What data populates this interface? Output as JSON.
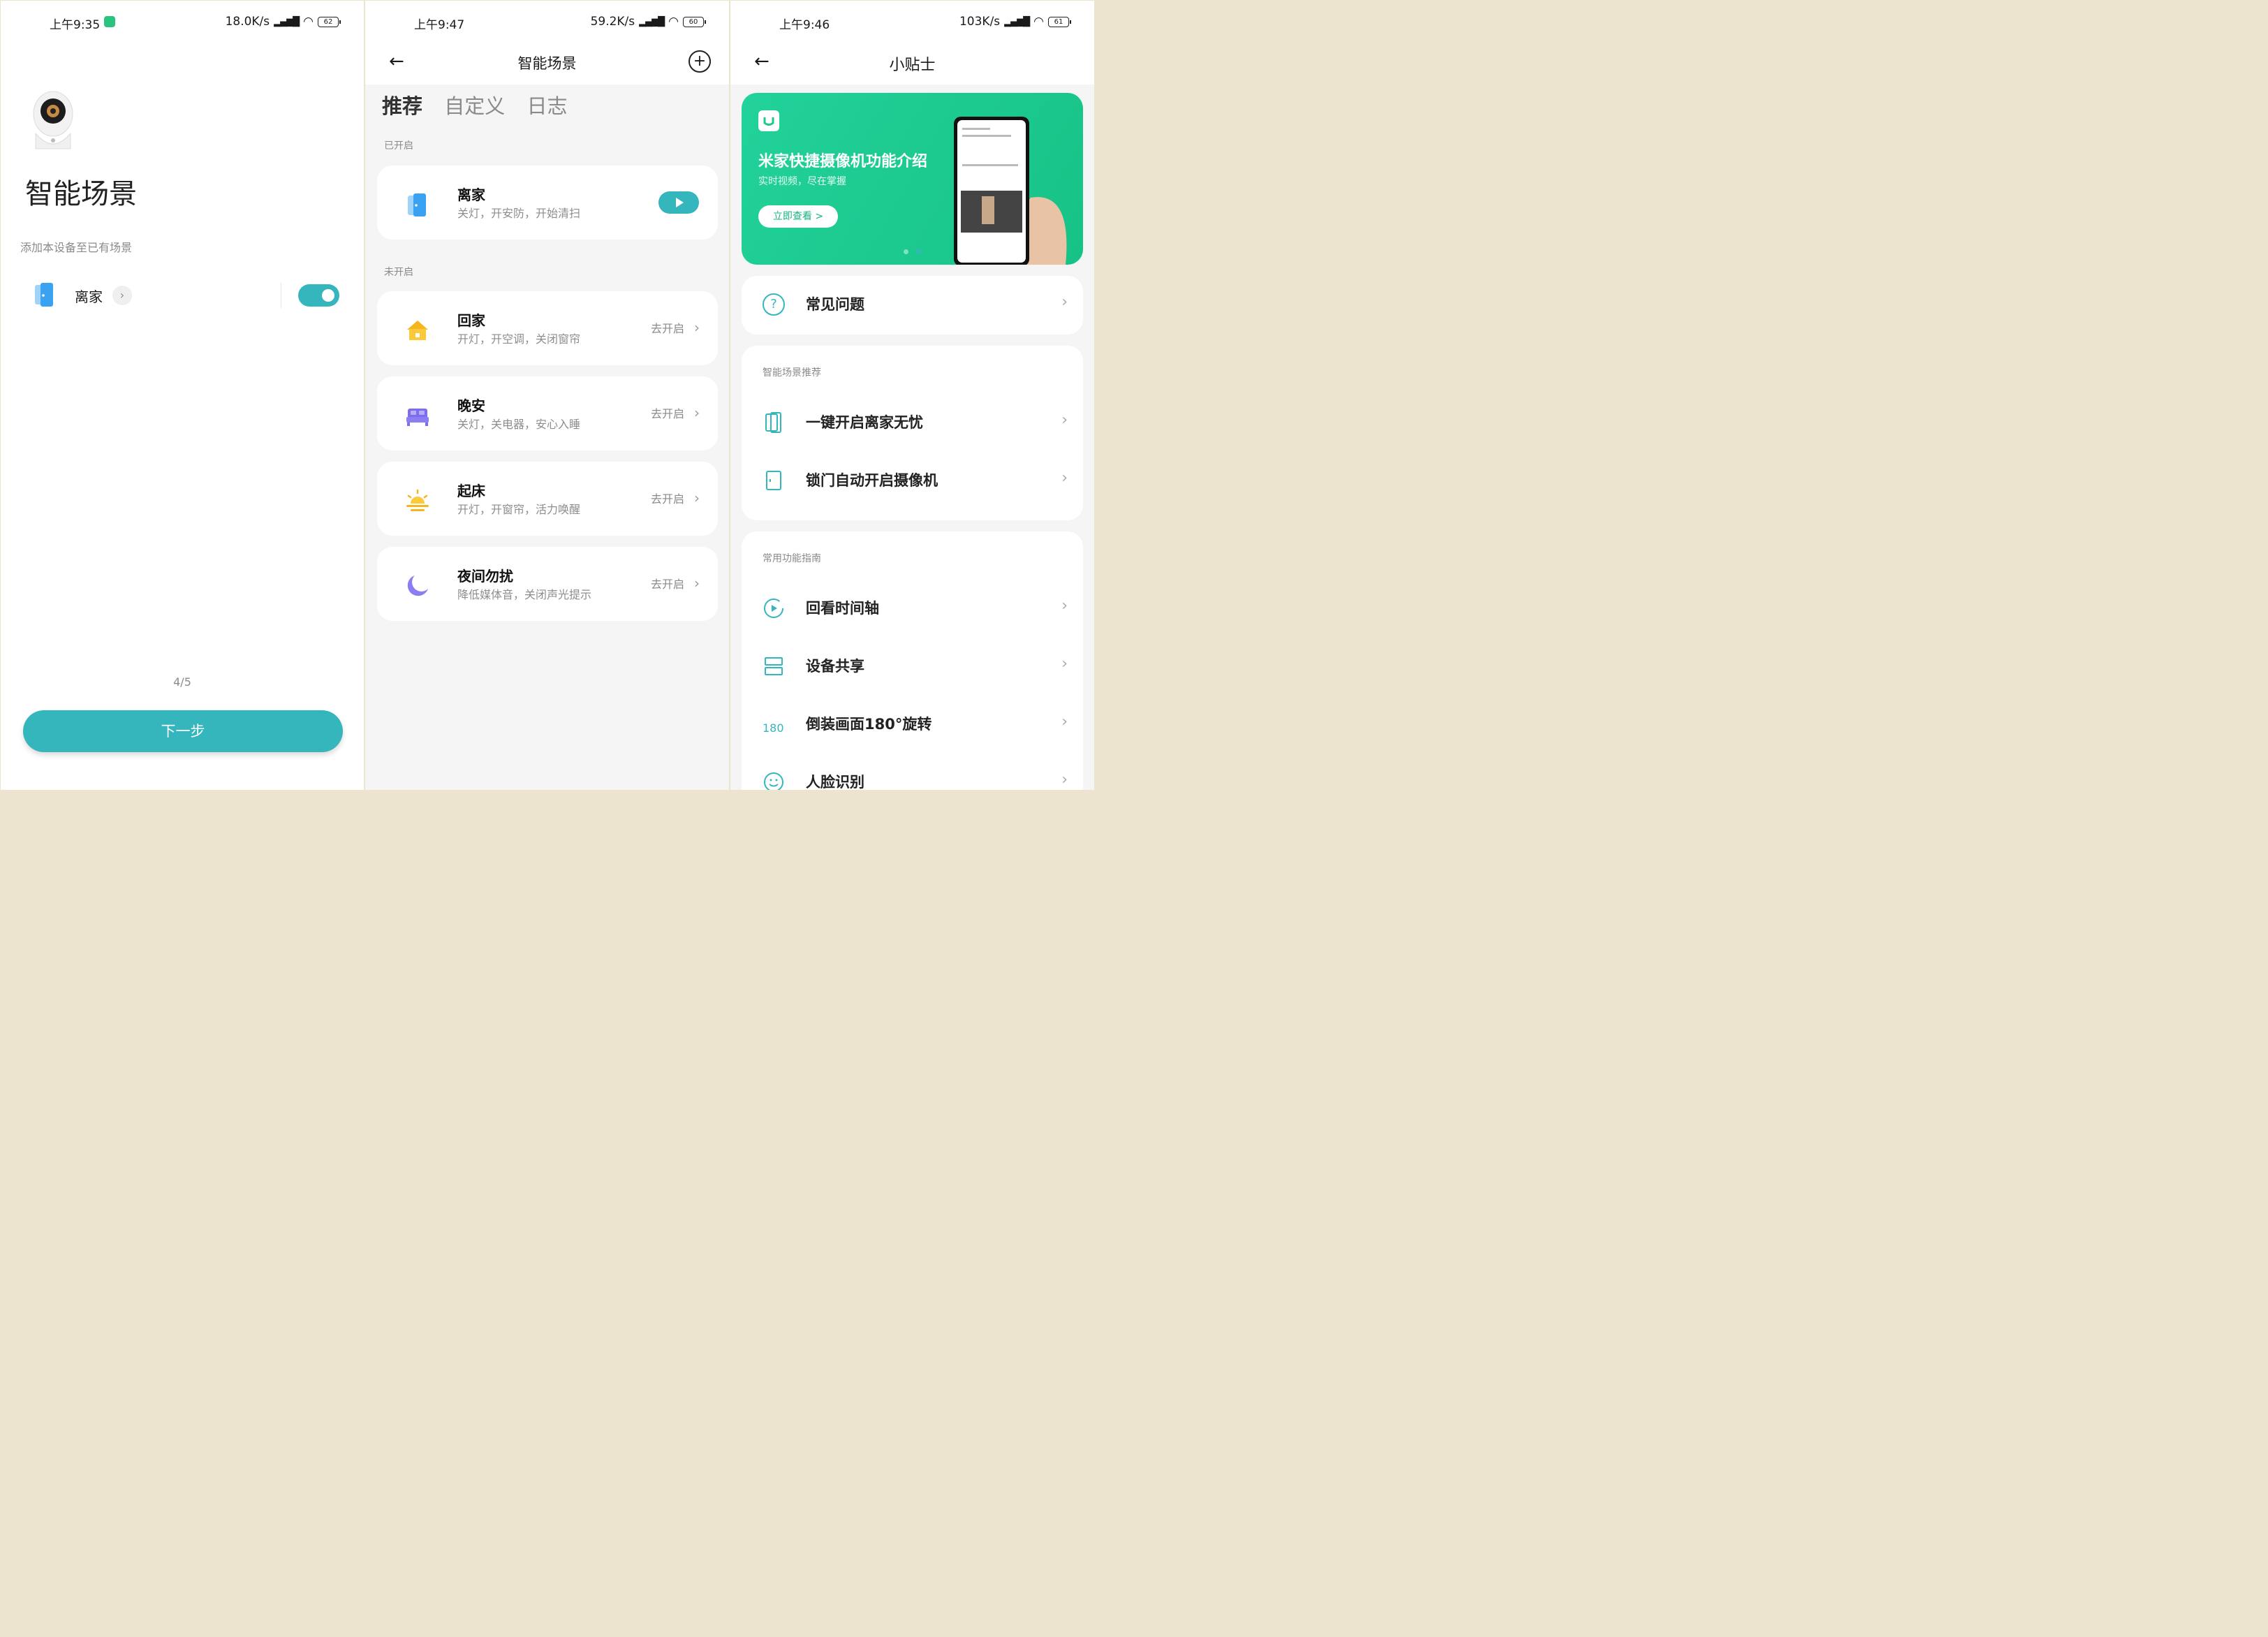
{
  "panel1": {
    "status": {
      "time": "上午9:35",
      "speed": "18.0K/s",
      "battery": "62"
    },
    "title": "智能场景",
    "subtitle": "添加本设备至已有场景",
    "scene_name": "离家",
    "page_indicator": "4/5",
    "next_button": "下一步",
    "toggle_on": true
  },
  "panel2": {
    "status": {
      "time": "上午9:47",
      "speed": "59.2K/s",
      "battery": "60"
    },
    "title": "智能场景",
    "tabs": [
      {
        "label": "推荐",
        "active": true
      },
      {
        "label": "自定义",
        "active": false
      },
      {
        "label": "日志",
        "active": false
      }
    ],
    "enabled_header": "已开启",
    "disabled_header": "未开启",
    "enabled": [
      {
        "name": "离家",
        "desc": "关灯，开安防，开始清扫",
        "icon": "door-icon"
      }
    ],
    "disabled": [
      {
        "name": "回家",
        "desc": "开灯，开空调，关闭窗帘",
        "action": "去开启",
        "icon": "house-icon"
      },
      {
        "name": "晚安",
        "desc": "关灯，关电器，安心入睡",
        "action": "去开启",
        "icon": "bed-icon"
      },
      {
        "name": "起床",
        "desc": "开灯，开窗帘，活力唤醒",
        "action": "去开启",
        "icon": "sunrise-icon"
      },
      {
        "name": "夜间勿扰",
        "desc": "降低媒体音，关闭声光提示",
        "action": "去开启",
        "icon": "moon-icon"
      }
    ]
  },
  "panel3": {
    "status": {
      "time": "上午9:46",
      "speed": "103K/s",
      "battery": "61"
    },
    "title": "小贴士",
    "banner": {
      "title": "米家快捷摄像机功能介绍",
      "subtitle": "实时视频，尽在掌握",
      "button": "立即查看 >"
    },
    "faq": "常见问题",
    "rec_header": "智能场景推荐",
    "rec_items": [
      {
        "label": "一键开启离家无忧",
        "icon": "door-icon"
      },
      {
        "label": "锁门自动开启摄像机",
        "icon": "lock-door-icon"
      }
    ],
    "guide_header": "常用功能指南",
    "guide_items": [
      {
        "label": "回看时间轴",
        "icon": "play-circle-icon"
      },
      {
        "label": "设备共享",
        "icon": "share-icon"
      },
      {
        "label": "倒装画面180°旋转",
        "icon": "rotate-180-icon",
        "icon_text": "180"
      },
      {
        "label": "人脸识别",
        "icon": "face-icon"
      }
    ]
  },
  "colors": {
    "accent": "#35b6bd",
    "banner": "#1fc98a"
  }
}
